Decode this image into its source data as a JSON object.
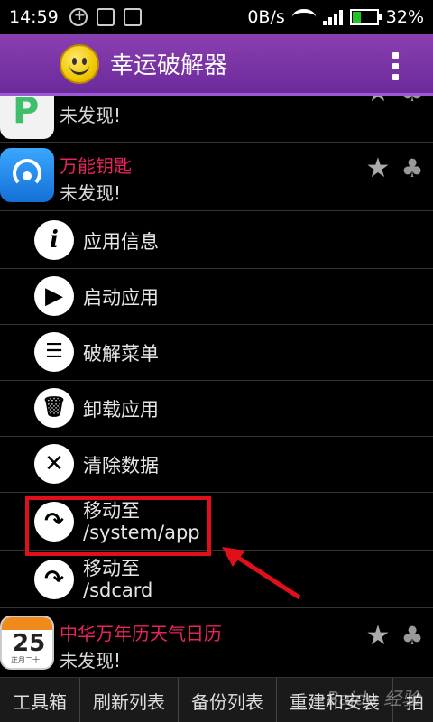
{
  "status_bar": {
    "time": "14:59",
    "net_speed": "0B/s",
    "battery": "32%"
  },
  "app_bar": {
    "title": "幸运破解器"
  },
  "apps": [
    {
      "name": "",
      "status": "未发现!"
    },
    {
      "name": "万能钥匙",
      "status": "未发现!"
    },
    {
      "name": "中华万年历天气日历",
      "status": "未发现!"
    }
  ],
  "calendar_icon": {
    "day": "25",
    "sub": "正月二十"
  },
  "menu": [
    {
      "label": "应用信息"
    },
    {
      "label": "启动应用"
    },
    {
      "label": "破解菜单"
    },
    {
      "label": "卸载应用"
    },
    {
      "label": "清除数据"
    },
    {
      "label": "移动至",
      "path": "/system/app"
    },
    {
      "label": "移动至",
      "path": "/sdcard"
    }
  ],
  "toolbar": {
    "items": [
      "工具箱",
      "刷新列表",
      "备份列表",
      "重建和安装",
      "拍"
    ]
  },
  "watermark": "Baidu 经验",
  "colors": {
    "accent": "#e8235a",
    "appbar": "#7b36a8",
    "highlight": "#e0101a"
  }
}
